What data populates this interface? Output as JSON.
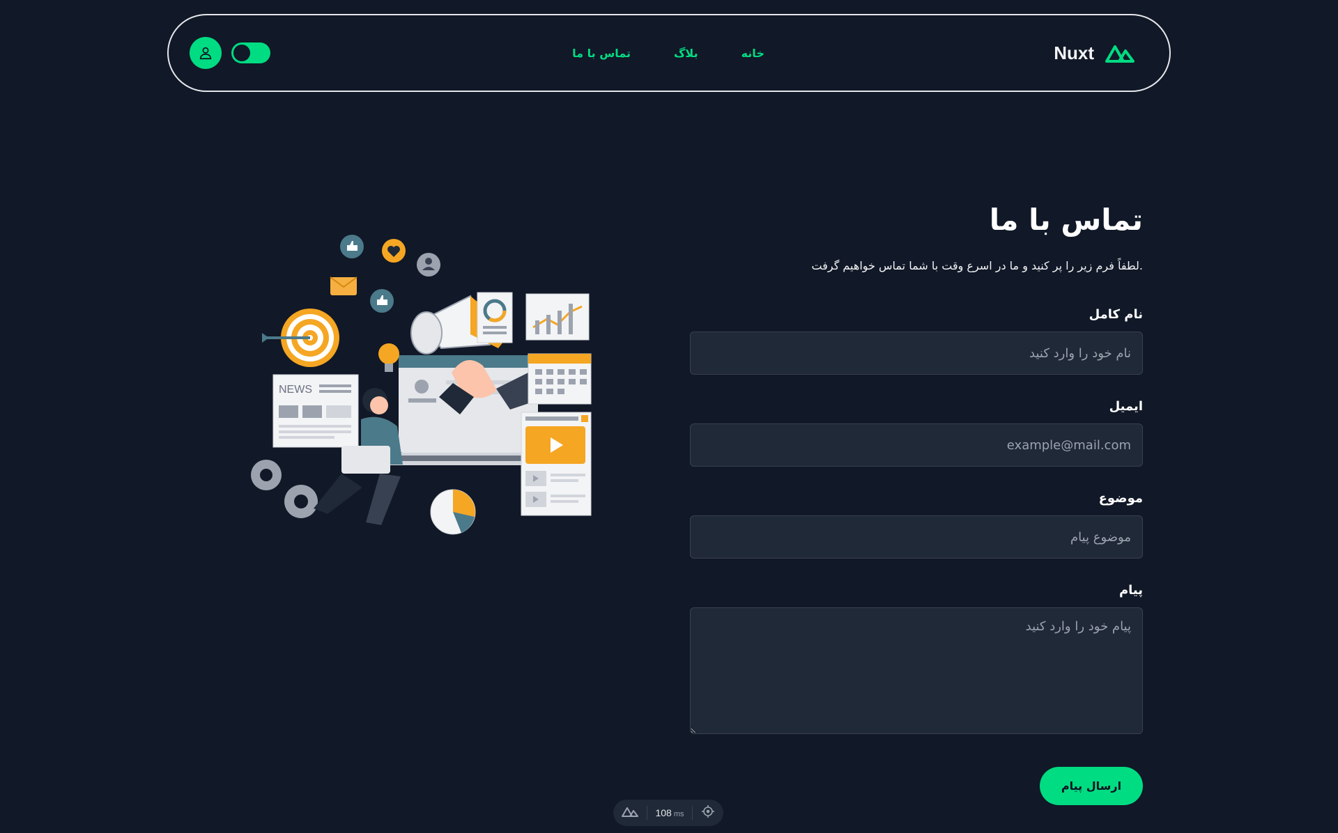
{
  "header": {
    "brand_name": "Nuxt",
    "nav": [
      {
        "label": "خانه"
      },
      {
        "label": "بلاگ"
      },
      {
        "label": "تماس با ما"
      }
    ],
    "toggle_state": "on"
  },
  "contact": {
    "title": "تماس با ما",
    "subtitle": ".لطفاً فرم زیر را پر کنید و ما در اسرع وقت با شما تماس خواهیم گرفت",
    "fields": {
      "name": {
        "label": "نام کامل",
        "placeholder": "نام خود را وارد کنید"
      },
      "email": {
        "label": "ایمیل",
        "placeholder": "example@mail.com"
      },
      "subject": {
        "label": "موضوع",
        "placeholder": "موضوع پیام"
      },
      "message": {
        "label": "پیام",
        "placeholder": "پیام خود را وارد کنید"
      }
    },
    "submit_label": "ارسال پیام"
  },
  "illustration": {
    "news_text": "NEWS"
  },
  "devtools": {
    "time_value": "108",
    "time_unit": "ms"
  },
  "colors": {
    "accent": "#00dc82",
    "background": "#111827",
    "field_bg": "#1f2937"
  }
}
